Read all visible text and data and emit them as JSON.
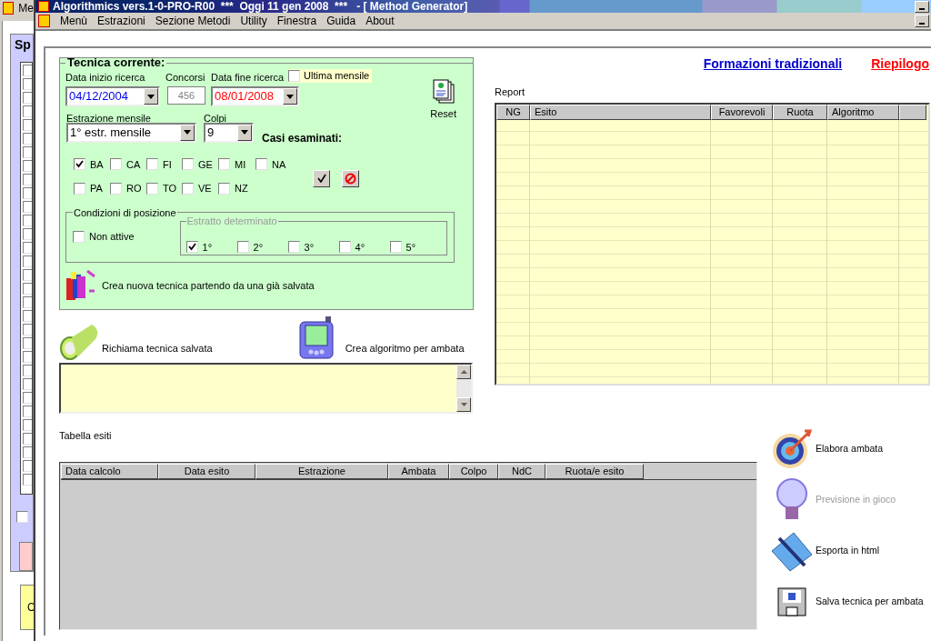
{
  "back_window": {
    "title": "Me",
    "panel_title": "Sp",
    "list_checkboxes": [
      {
        "checked": false
      },
      {
        "checked": false
      },
      {
        "checked": false
      },
      {
        "checked": false
      },
      {
        "checked": false
      },
      {
        "checked": false
      },
      {
        "checked": false
      },
      {
        "checked": false
      },
      {
        "checked": false
      },
      {
        "checked": false
      },
      {
        "checked": false
      },
      {
        "checked": false
      },
      {
        "checked": false
      },
      {
        "checked": false
      },
      {
        "checked": false
      },
      {
        "checked": false
      },
      {
        "checked": false
      },
      {
        "checked": false
      },
      {
        "checked": false
      },
      {
        "checked": false
      },
      {
        "checked": false
      },
      {
        "checked": false
      },
      {
        "checked": false
      },
      {
        "checked": false
      },
      {
        "checked": false
      },
      {
        "checked": false
      },
      {
        "checked": false
      },
      {
        "checked": false
      },
      {
        "checked": false
      },
      {
        "checked": false
      },
      {
        "checked": false
      }
    ],
    "option_checkbox": {
      "checked": false
    },
    "yellow_button": "C"
  },
  "window": {
    "title": "Algorithmics vers.1-0-PRO-R00  ***  Oggi 11 gen 2008  ***   - [ Method Generator]"
  },
  "menu": [
    "Menù",
    "Estrazioni",
    "Sezione Metodi",
    "Utility",
    "Finestra",
    "Guida",
    "About"
  ],
  "links": [
    {
      "text": "Formazioni tradizionali",
      "color": "#0000cc"
    },
    {
      "text": "Riepilogo",
      "color": "#ff0000"
    }
  ],
  "tecnica": {
    "title": "Tecnica corrente:",
    "date_start": {
      "label": "Data inizio ricerca",
      "value": "04/12/2004"
    },
    "concorsi": {
      "label": "Concorsi",
      "value": "456",
      "disabled": true
    },
    "date_end": {
      "label": "Data fine ricerca",
      "value": "08/01/2008"
    },
    "ultima_mensile": {
      "label": "Ultima mensile",
      "checked": false
    },
    "reset": "Reset",
    "estrazione": {
      "label": "Estrazione mensile",
      "value": "1° estr. mensile"
    },
    "colpi": {
      "label": "Colpi",
      "value": "9"
    },
    "casi_label": "Casi esaminati:",
    "ruote": [
      {
        "label": "BA",
        "checked": true
      },
      {
        "label": "CA",
        "checked": false
      },
      {
        "label": "FI",
        "checked": false
      },
      {
        "label": "GE",
        "checked": false
      },
      {
        "label": "MI",
        "checked": false
      },
      {
        "label": "NA",
        "checked": false
      },
      {
        "label": "PA",
        "checked": false
      },
      {
        "label": "RO",
        "checked": false
      },
      {
        "label": "TO",
        "checked": false
      },
      {
        "label": "VE",
        "checked": false
      },
      {
        "label": "NZ",
        "checked": false
      }
    ],
    "posizione": {
      "title": "Condizioni di posizione",
      "non_attive": {
        "label": "Non attive",
        "checked": false
      },
      "estratto_title": "Estratto determinato",
      "options": [
        {
          "label": "1°",
          "checked": true
        },
        {
          "label": "2°",
          "checked": false
        },
        {
          "label": "3°",
          "checked": false
        },
        {
          "label": "4°",
          "checked": false
        },
        {
          "label": "5°",
          "checked": false
        }
      ]
    },
    "crea_nuova": "Crea nuova tecnica partendo da una già salvata"
  },
  "richiama": "Richiama tecnica salvata",
  "crea_algoritmo": "Crea algoritmo per ambata",
  "report": {
    "label": "Report",
    "columns": [
      "NG",
      "Esito",
      "Favorevoli",
      "Ruota",
      "Algoritmo"
    ]
  },
  "tabella": {
    "label": "Tabella esiti",
    "columns": [
      "Data calcolo",
      "Data esito",
      "Estrazione",
      "Ambata",
      "Colpo",
      "NdC",
      "Ruota/e esito"
    ]
  },
  "side_actions": [
    {
      "kind": "target",
      "label": "Elabora ambata",
      "disabled": false
    },
    {
      "kind": "bulb",
      "label": "Previsione in gioco",
      "disabled": true
    },
    {
      "kind": "book",
      "label": "Esporta in html",
      "disabled": false
    },
    {
      "kind": "floppy",
      "label": "Salva tecnica per ambata",
      "disabled": false
    }
  ]
}
